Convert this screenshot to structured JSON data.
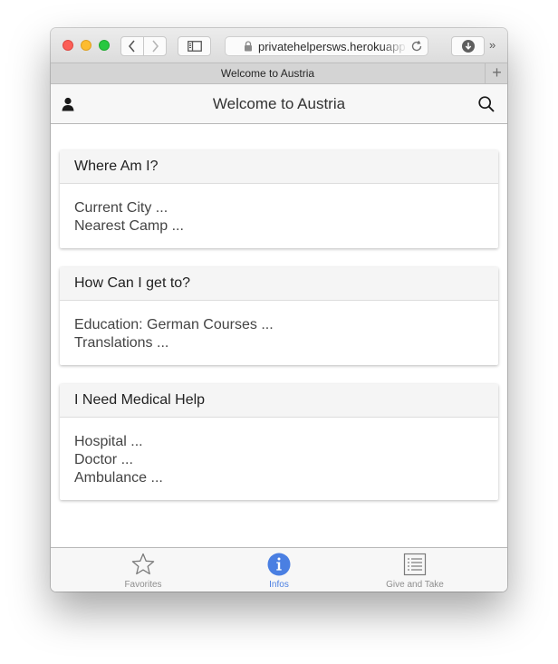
{
  "browser": {
    "url": "privatehelpersws.herokuapp",
    "tab_title": "Welcome to Austria",
    "new_tab": "+",
    "more": "»"
  },
  "header": {
    "title": "Welcome to Austria"
  },
  "cards": [
    {
      "title": "Where Am I?",
      "items": [
        "Current City ...",
        "Nearest Camp ..."
      ]
    },
    {
      "title": "How Can I get to?",
      "items": [
        "Education: German Courses ...",
        "Translations ..."
      ]
    },
    {
      "title": "I Need Medical Help",
      "items": [
        "Hospital ...",
        "Doctor ...",
        "Ambulance ..."
      ]
    }
  ],
  "tabbar": {
    "items": [
      {
        "label": "Favorites",
        "icon": "star-icon"
      },
      {
        "label": "Infos",
        "icon": "info-icon",
        "active": true
      },
      {
        "label": "Give and Take",
        "icon": "list-icon"
      }
    ],
    "active_color": "#4a7fe2"
  }
}
